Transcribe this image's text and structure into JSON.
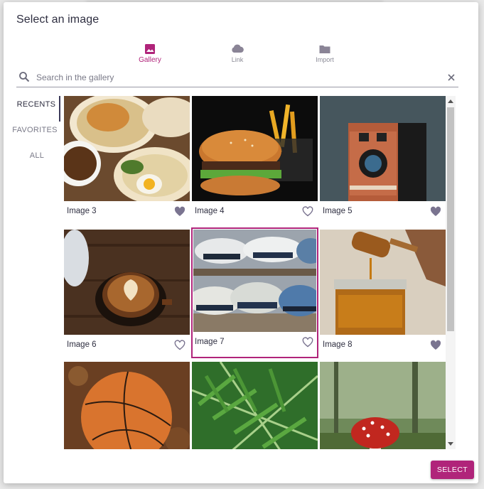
{
  "dialog": {
    "title": "Select an image",
    "select_label": "SELECT"
  },
  "tabs": [
    {
      "label": "Gallery",
      "icon": "image-icon",
      "active": true
    },
    {
      "label": "Link",
      "icon": "cloud-icon",
      "active": false
    },
    {
      "label": "Import",
      "icon": "folder-icon",
      "active": false
    }
  ],
  "search": {
    "placeholder": "Search in the gallery",
    "value": ""
  },
  "sidebar": {
    "items": [
      {
        "label": "RECENTS",
        "active": true
      },
      {
        "label": "FAVORITES",
        "active": false
      },
      {
        "label": "ALL",
        "active": false
      }
    ]
  },
  "gallery": {
    "items": [
      {
        "label": "Image 3",
        "subject": "breakfast",
        "favorite": true,
        "selected": false
      },
      {
        "label": "Image 4",
        "subject": "burger",
        "favorite": false,
        "selected": false
      },
      {
        "label": "Image 5",
        "subject": "camera",
        "favorite": true,
        "selected": false
      },
      {
        "label": "Image 6",
        "subject": "coffee",
        "favorite": false,
        "selected": false
      },
      {
        "label": "Image 7",
        "subject": "hats",
        "favorite": false,
        "selected": true
      },
      {
        "label": "Image 8",
        "subject": "honey",
        "favorite": true,
        "selected": false
      },
      {
        "label": "",
        "subject": "basketball",
        "favorite": false,
        "selected": false
      },
      {
        "label": "",
        "subject": "fern",
        "favorite": false,
        "selected": false
      },
      {
        "label": "",
        "subject": "mushroom",
        "favorite": false,
        "selected": false
      }
    ]
  },
  "colors": {
    "accent": "#b0247a",
    "tab_icon": "#8a8496",
    "heart_filled": "#7a7490"
  }
}
